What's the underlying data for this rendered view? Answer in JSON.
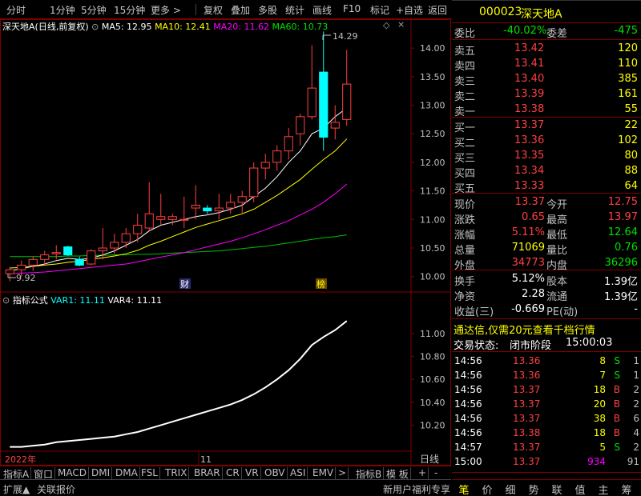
{
  "toolbar": {
    "left_items": [
      "分时",
      "1分钟",
      "5分钟",
      "15分钟",
      "更多 >"
    ],
    "right_items": [
      "复权",
      "叠加",
      "多股",
      "统计",
      "画线",
      "F10",
      "标记",
      "+自选",
      "返回"
    ]
  },
  "main_legend": {
    "stock": "深天地A",
    "mode": "(日线,前复权)",
    "ma5": "MA5: 12.95",
    "ma10": "MA10: 12.41",
    "ma20": "MA20: 11.62",
    "ma60": "MA60: 10.73"
  },
  "indicator_legend": {
    "name": "指标公式",
    "var1": "VAR1: 11.11",
    "var4": "VAR4: 11.11"
  },
  "markers": {
    "high_label": "14.29",
    "low_label": "9.92",
    "finance_tag": "财",
    "rank_tag": "榜"
  },
  "date_axis": {
    "year": "2022年",
    "month": "11"
  },
  "period_label": "日线",
  "bottom_tabs": [
    "指标A",
    "窗口",
    "MACD",
    "DMI",
    "DMA",
    "FSL",
    "TRIX",
    "BRAR",
    "CR",
    "VR",
    "OBV",
    "ASI",
    "EMV",
    ">",
    "指标B",
    "模 板",
    "+",
    "-"
  ],
  "status_left": [
    "扩展▲",
    "关联报价"
  ],
  "status_right": "新用户福利专享",
  "colors": {
    "up": "#ff4040",
    "down": "#00ffff",
    "ma5": "#ffffff",
    "ma10": "#ffff00",
    "ma20": "#ff00ff",
    "ma60": "#00c000",
    "bg": "#000000",
    "frame": "#800000"
  },
  "chart_data": [
    {
      "type": "candlestick",
      "title": "深天地A (日线,前复权)",
      "y_ticks": [
        "14.00",
        "13.50",
        "13.00",
        "12.50",
        "12.00",
        "11.50",
        "11.00",
        "10.50",
        "10.00"
      ],
      "ylim": [
        9.8,
        14.45
      ],
      "candles": [
        {
          "o": 10.05,
          "h": 10.17,
          "l": 9.92,
          "c": 10.12
        },
        {
          "o": 10.12,
          "h": 10.28,
          "l": 10.0,
          "c": 10.2
        },
        {
          "o": 10.2,
          "h": 10.35,
          "l": 10.1,
          "c": 10.3
        },
        {
          "o": 10.3,
          "h": 10.45,
          "l": 10.2,
          "c": 10.38
        },
        {
          "o": 10.4,
          "h": 10.55,
          "l": 10.3,
          "c": 10.42
        },
        {
          "o": 10.52,
          "h": 10.54,
          "l": 10.36,
          "c": 10.38
        },
        {
          "o": 10.3,
          "h": 10.35,
          "l": 10.18,
          "c": 10.2
        },
        {
          "o": 10.22,
          "h": 10.48,
          "l": 10.2,
          "c": 10.45
        },
        {
          "o": 10.45,
          "h": 10.85,
          "l": 10.3,
          "c": 10.5
        },
        {
          "o": 10.5,
          "h": 10.75,
          "l": 10.4,
          "c": 10.6
        },
        {
          "o": 10.6,
          "h": 10.85,
          "l": 10.5,
          "c": 10.75
        },
        {
          "o": 10.75,
          "h": 11.1,
          "l": 10.6,
          "c": 10.9
        },
        {
          "o": 10.85,
          "h": 11.65,
          "l": 10.8,
          "c": 11.1
        },
        {
          "o": 11.0,
          "h": 11.45,
          "l": 10.9,
          "c": 11.05
        },
        {
          "o": 11.0,
          "h": 11.1,
          "l": 10.9,
          "c": 11.05
        },
        {
          "o": 11.0,
          "h": 11.4,
          "l": 10.85,
          "c": 11.0
        },
        {
          "o": 11.2,
          "h": 11.6,
          "l": 11.0,
          "c": 11.25
        },
        {
          "o": 11.2,
          "h": 11.25,
          "l": 11.1,
          "c": 11.15
        },
        {
          "o": 11.15,
          "h": 11.45,
          "l": 11.0,
          "c": 11.2
        },
        {
          "o": 11.2,
          "h": 11.45,
          "l": 11.1,
          "c": 11.3
        },
        {
          "o": 11.3,
          "h": 11.5,
          "l": 11.1,
          "c": 11.4
        },
        {
          "o": 11.4,
          "h": 12.0,
          "l": 11.3,
          "c": 11.9
        },
        {
          "o": 11.9,
          "h": 12.15,
          "l": 11.7,
          "c": 12.0
        },
        {
          "o": 12.0,
          "h": 12.3,
          "l": 11.85,
          "c": 12.2
        },
        {
          "o": 12.2,
          "h": 12.6,
          "l": 12.05,
          "c": 12.45
        },
        {
          "o": 12.5,
          "h": 12.85,
          "l": 12.3,
          "c": 12.8
        },
        {
          "o": 12.8,
          "h": 14.05,
          "l": 12.75,
          "c": 13.3
        },
        {
          "o": 13.58,
          "h": 14.29,
          "l": 12.2,
          "c": 12.44
        },
        {
          "o": 12.6,
          "h": 13.0,
          "l": 12.4,
          "c": 12.7
        },
        {
          "o": 12.75,
          "h": 13.97,
          "l": 12.64,
          "c": 13.37
        }
      ],
      "ma5": [
        10.1,
        10.14,
        10.18,
        10.22,
        10.28,
        10.32,
        10.3,
        10.32,
        10.38,
        10.45,
        10.55,
        10.65,
        10.8,
        10.9,
        10.95,
        11.0,
        11.05,
        11.08,
        11.12,
        11.18,
        11.25,
        11.4,
        11.55,
        11.75,
        12.0,
        12.2,
        12.5,
        12.6,
        12.8,
        12.95
      ],
      "ma10": [
        10.15,
        10.16,
        10.18,
        10.2,
        10.22,
        10.25,
        10.27,
        10.3,
        10.33,
        10.36,
        10.4,
        10.46,
        10.55,
        10.62,
        10.7,
        10.78,
        10.86,
        10.92,
        10.98,
        11.04,
        11.1,
        11.18,
        11.3,
        11.42,
        11.56,
        11.7,
        11.88,
        12.05,
        12.2,
        12.41
      ],
      "ma20": [
        10.05,
        10.06,
        10.07,
        10.08,
        10.1,
        10.12,
        10.14,
        10.16,
        10.18,
        10.2,
        10.22,
        10.26,
        10.3,
        10.34,
        10.38,
        10.42,
        10.47,
        10.52,
        10.57,
        10.62,
        10.68,
        10.75,
        10.82,
        10.9,
        10.98,
        11.08,
        11.18,
        11.3,
        11.45,
        11.62
      ],
      "ma60": [
        10.35,
        10.35,
        10.35,
        10.35,
        10.35,
        10.36,
        10.36,
        10.37,
        10.37,
        10.38,
        10.38,
        10.39,
        10.39,
        10.4,
        10.41,
        10.42,
        10.43,
        10.44,
        10.45,
        10.47,
        10.49,
        10.51,
        10.53,
        10.56,
        10.59,
        10.62,
        10.65,
        10.68,
        10.7,
        10.73
      ]
    },
    {
      "type": "line",
      "title": "指标公式",
      "y_ticks": [
        "11.00",
        "10.80",
        "10.60",
        "10.40",
        "10.20"
      ],
      "ylim": [
        10.0,
        11.3
      ],
      "series": [
        {
          "name": "VAR1",
          "values": [
            10.01,
            10.01,
            10.02,
            10.03,
            10.05,
            10.06,
            10.07,
            10.08,
            10.09,
            10.1,
            10.12,
            10.14,
            10.17,
            10.2,
            10.23,
            10.26,
            10.29,
            10.32,
            10.35,
            10.38,
            10.42,
            10.47,
            10.53,
            10.6,
            10.68,
            10.78,
            10.9,
            10.97,
            11.03,
            11.11
          ]
        }
      ]
    }
  ],
  "quote": {
    "code": "000023",
    "name": "深天地A",
    "weibi_label": "委比",
    "weibi_value": "-40.02%",
    "weicha_label": "委差",
    "weicha_value": "-475",
    "sells": [
      {
        "label": "卖五",
        "price": "13.42",
        "vol": "120"
      },
      {
        "label": "卖四",
        "price": "13.41",
        "vol": "110"
      },
      {
        "label": "卖三",
        "price": "13.40",
        "vol": "385"
      },
      {
        "label": "卖二",
        "price": "13.39",
        "vol": "161"
      },
      {
        "label": "卖一",
        "price": "13.38",
        "vol": "55"
      }
    ],
    "buys": [
      {
        "label": "买一",
        "price": "13.37",
        "vol": "22"
      },
      {
        "label": "买二",
        "price": "13.36",
        "vol": "102"
      },
      {
        "label": "买三",
        "price": "13.35",
        "vol": "80"
      },
      {
        "label": "买四",
        "price": "13.34",
        "vol": "88"
      },
      {
        "label": "买五",
        "price": "13.33",
        "vol": "64"
      }
    ],
    "stats": [
      {
        "l1": "现价",
        "v1": "13.37",
        "c1": "c-red",
        "l2": "今开",
        "v2": "12.75",
        "c2": "c-red"
      },
      {
        "l1": "涨跌",
        "v1": "0.65",
        "c1": "c-red",
        "l2": "最高",
        "v2": "13.97",
        "c2": "c-red"
      },
      {
        "l1": "涨幅",
        "v1": "5.11%",
        "c1": "c-red",
        "l2": "最低",
        "v2": "12.64",
        "c2": "c-green"
      },
      {
        "l1": "总量",
        "v1": "71069",
        "c1": "c-yellow",
        "l2": "量比",
        "v2": "0.76",
        "c2": "c-green"
      },
      {
        "l1": "外盘",
        "v1": "34773",
        "c1": "c-red",
        "l2": "内盘",
        "v2": "36296",
        "c2": "c-green"
      }
    ],
    "stats2": [
      {
        "l1": "换手",
        "v1": "5.12%",
        "l2": "股本",
        "v2": "1.39亿"
      },
      {
        "l1": "净资",
        "v1": "2.28",
        "l2": "流通",
        "v2": "1.39亿"
      },
      {
        "l1": "收益(三)",
        "v1": "-0.669",
        "l2": "PE(动)",
        "v2": "-"
      }
    ],
    "promo": "通达信,仅需20元查看千档行情",
    "trade_status_label": "交易状态:",
    "trade_status": "闭市阶段",
    "trade_time": "15:00:03",
    "ticks": [
      {
        "t": "14:56",
        "p": "13.36",
        "v": "8",
        "s": "S",
        "n": "1",
        "vc": "c-yellow",
        "sc": "c-green"
      },
      {
        "t": "14:56",
        "p": "13.36",
        "v": "7",
        "s": "S",
        "n": "1",
        "vc": "c-yellow",
        "sc": "c-green"
      },
      {
        "t": "14:56",
        "p": "13.37",
        "v": "18",
        "s": "B",
        "n": "2",
        "vc": "c-yellow",
        "sc": "c-red"
      },
      {
        "t": "14:56",
        "p": "13.37",
        "v": "20",
        "s": "B",
        "n": "2",
        "vc": "c-yellow",
        "sc": "c-red"
      },
      {
        "t": "14:56",
        "p": "13.37",
        "v": "38",
        "s": "B",
        "n": "6",
        "vc": "c-yellow",
        "sc": "c-red"
      },
      {
        "t": "14:56",
        "p": "13.38",
        "v": "18",
        "s": "B",
        "n": "4",
        "vc": "c-yellow",
        "sc": "c-red"
      },
      {
        "t": "14:57",
        "p": "13.37",
        "v": "5",
        "s": "S",
        "n": "2",
        "vc": "c-yellow",
        "sc": "c-green"
      },
      {
        "t": "15:00",
        "p": "13.37",
        "v": "934",
        "s": "",
        "n": "91",
        "vc": "c-mag",
        "sc": "c-gray"
      }
    ]
  },
  "right_tabs": [
    "笔",
    "价",
    "细",
    "势",
    "联",
    "值",
    "主",
    "筹"
  ]
}
